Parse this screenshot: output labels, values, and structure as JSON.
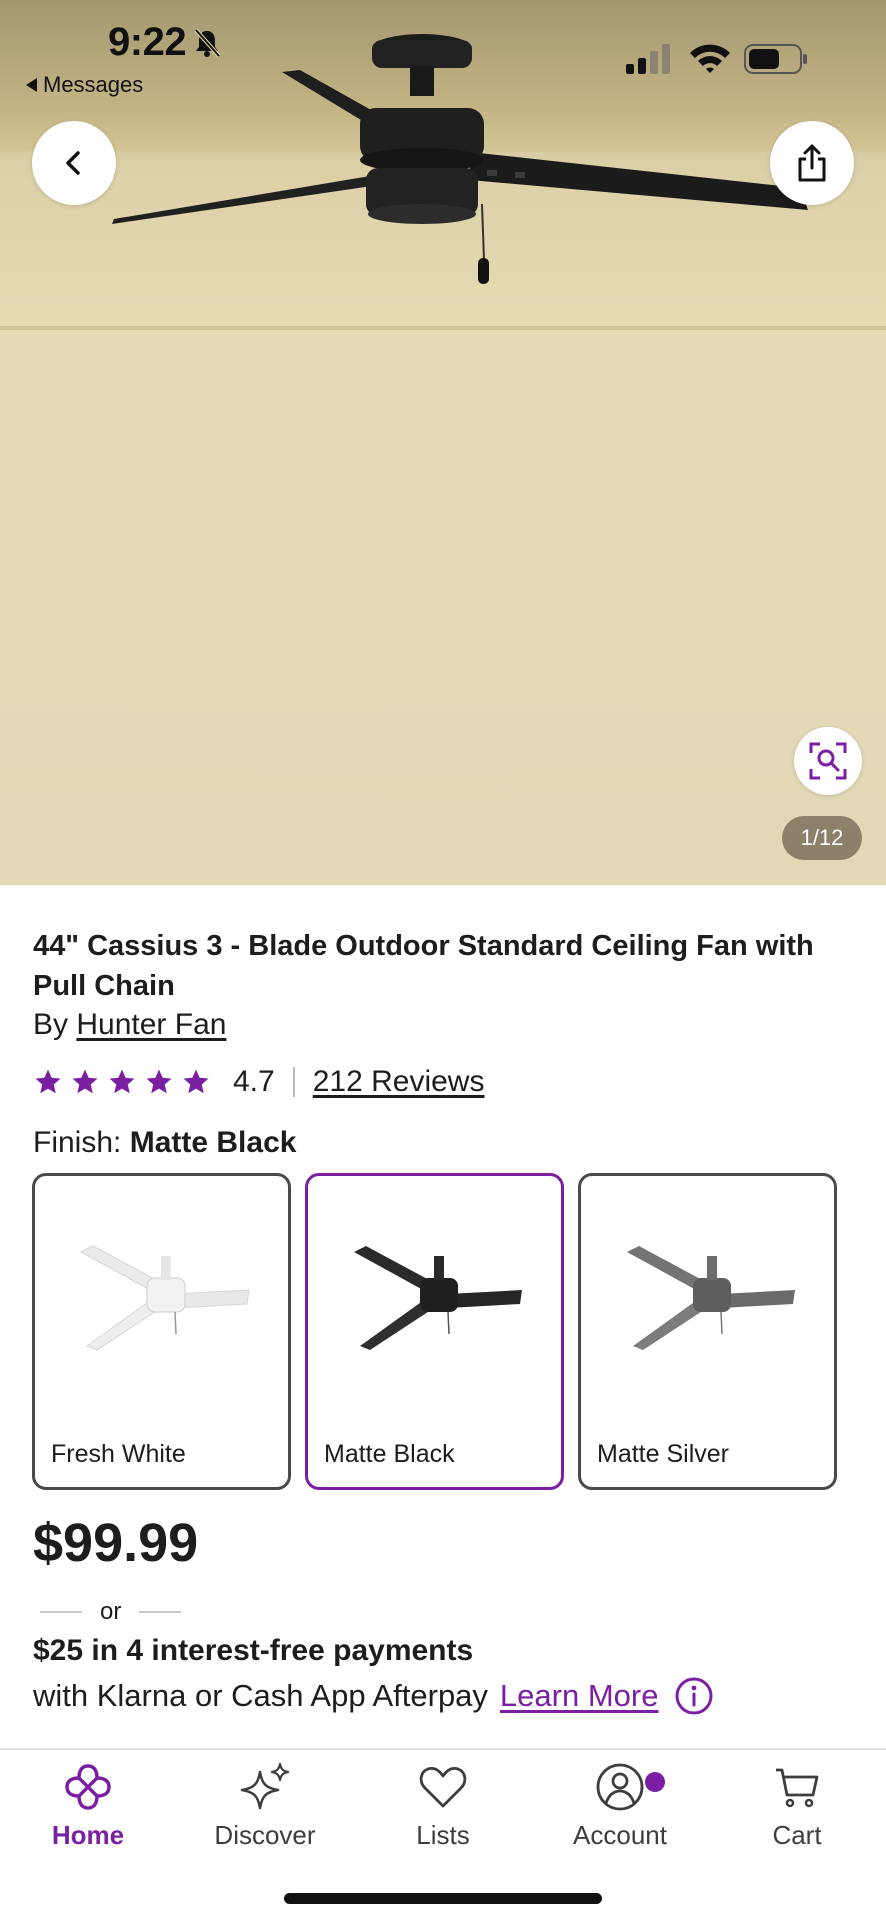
{
  "status_bar": {
    "time": "9:22",
    "back_app": "Messages"
  },
  "gallery": {
    "counter": "1/12"
  },
  "product": {
    "title": "44\" Cassius 3 - Blade Outdoor Standard Ceiling Fan with Pull Chain",
    "by_prefix": "By",
    "brand": "Hunter Fan",
    "rating": "4.7",
    "rating_stars": 5,
    "reviews": "212 Reviews",
    "finish_label": "Finish:",
    "finish_selected": "Matte Black",
    "finishes": [
      {
        "label": "Fresh White",
        "color": "#f0f0ee"
      },
      {
        "label": "Matte Black",
        "color": "#2b2b2b"
      },
      {
        "label": "Matte Silver",
        "color": "#6f6f6f"
      }
    ],
    "price": "$99.99",
    "or_text": "or",
    "installments": "$25 in 4 interest-free payments",
    "installments_provider": "with Klarna or Cash App Afterpay",
    "learn_more": "Learn More"
  },
  "nav": {
    "home": "Home",
    "discover": "Discover",
    "lists": "Lists",
    "account": "Account",
    "cart": "Cart"
  },
  "colors": {
    "accent": "#7b1fa2",
    "text": "#1d1d1f",
    "wall": "#e4dab6"
  },
  "icons": [
    "back-arrow-icon",
    "share-icon",
    "zoom-search-icon",
    "star-icon",
    "info-icon",
    "home-icon",
    "discover-sparkle-icon",
    "heart-icon",
    "account-icon",
    "cart-icon"
  ]
}
